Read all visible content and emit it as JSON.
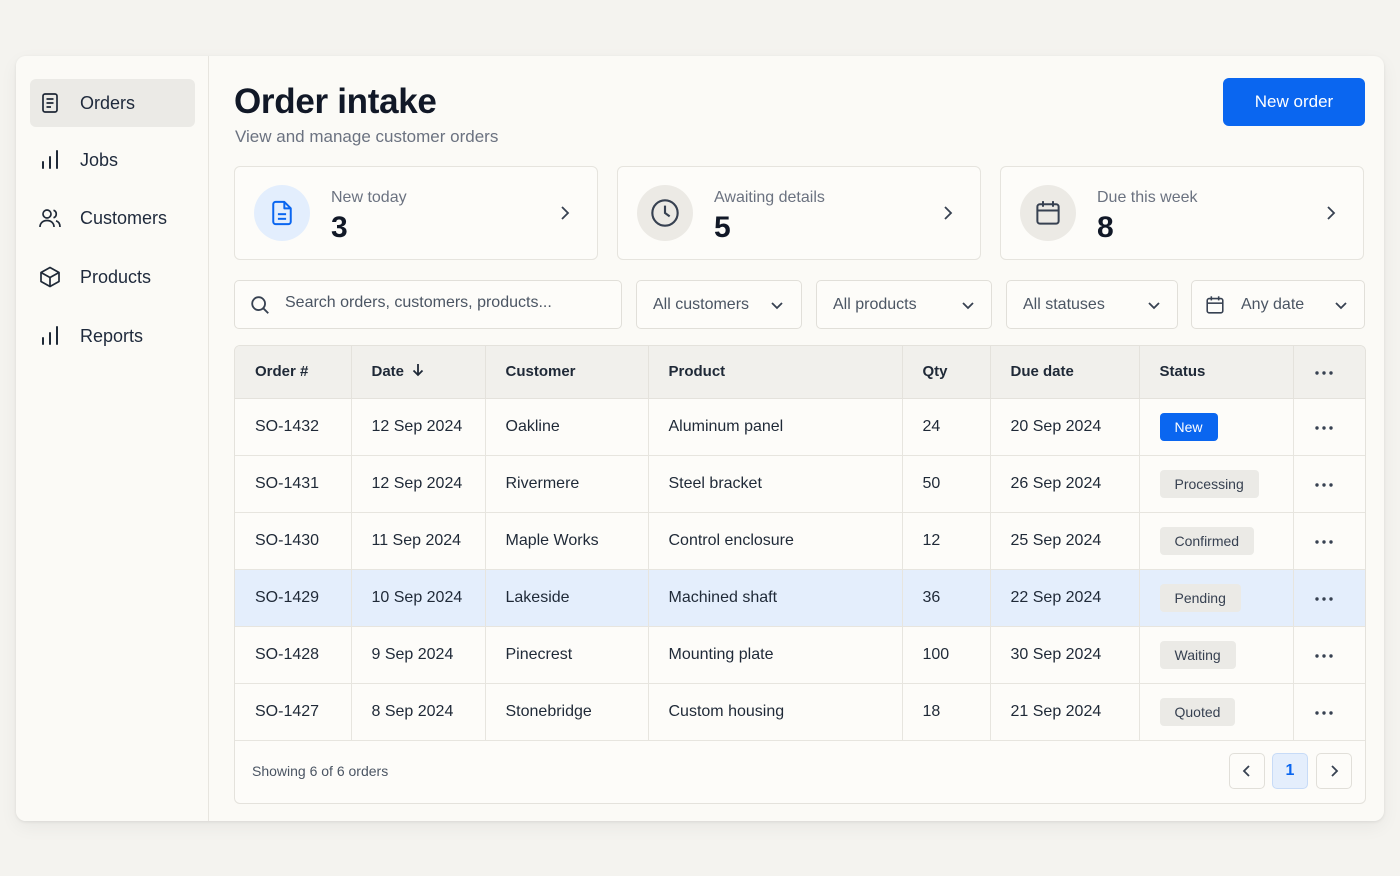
{
  "sidebar": {
    "items": [
      {
        "label": "Orders",
        "icon": "document-icon"
      },
      {
        "label": "Jobs",
        "icon": "bar-chart-icon"
      },
      {
        "label": "Customers",
        "icon": "users-icon"
      },
      {
        "label": "Products",
        "icon": "box-icon"
      },
      {
        "label": "Reports",
        "icon": "bar-chart-icon"
      }
    ]
  },
  "header": {
    "title": "Order intake",
    "subtitle": "View and manage customer orders",
    "new_order_label": "New order"
  },
  "cards": [
    {
      "label": "New today",
      "value": "3",
      "icon": "file-icon"
    },
    {
      "label": "Awaiting details",
      "value": "5",
      "icon": "clock-icon"
    },
    {
      "label": "Due this week",
      "value": "8",
      "icon": "calendar-icon"
    }
  ],
  "filters": {
    "search_placeholder": "Search orders, customers, products...",
    "customers": "All customers",
    "products": "All products",
    "statuses": "All statuses",
    "date": "Any date"
  },
  "table": {
    "headers": [
      "Order #",
      "Date",
      "Customer",
      "Product",
      "Qty",
      "Due date",
      "Status"
    ],
    "rows": [
      {
        "order": "SO-1432",
        "date": "12 Sep 2024",
        "customer": "Oakline",
        "product": "Aluminum panel",
        "qty": "24",
        "due": "20 Sep 2024",
        "status": "New"
      },
      {
        "order": "SO-1431",
        "date": "12 Sep 2024",
        "customer": "Rivermere",
        "product": "Steel bracket",
        "qty": "50",
        "due": "26 Sep 2024",
        "status": "Processing"
      },
      {
        "order": "SO-1430",
        "date": "11 Sep 2024",
        "customer": "Maple Works",
        "product": "Control enclosure",
        "qty": "12",
        "due": "25 Sep 2024",
        "status": "Confirmed"
      },
      {
        "order": "SO-1429",
        "date": "10 Sep 2024",
        "customer": "Lakeside",
        "product": "Machined shaft",
        "qty": "36",
        "due": "22 Sep 2024",
        "status": "Pending"
      },
      {
        "order": "SO-1428",
        "date": "9 Sep 2024",
        "customer": "Pinecrest",
        "product": "Mounting plate",
        "qty": "100",
        "due": "30 Sep 2024",
        "status": "Waiting"
      },
      {
        "order": "SO-1427",
        "date": "8 Sep 2024",
        "customer": "Stonebridge",
        "product": "Custom housing",
        "qty": "18",
        "due": "21 Sep 2024",
        "status": "Quoted"
      }
    ],
    "footer": "Showing 6 of 6 orders",
    "current_page": "1"
  },
  "colors": {
    "accent": "#0a66f0",
    "highlight_row": "#e4eefc",
    "background": "#f4f3ef"
  }
}
